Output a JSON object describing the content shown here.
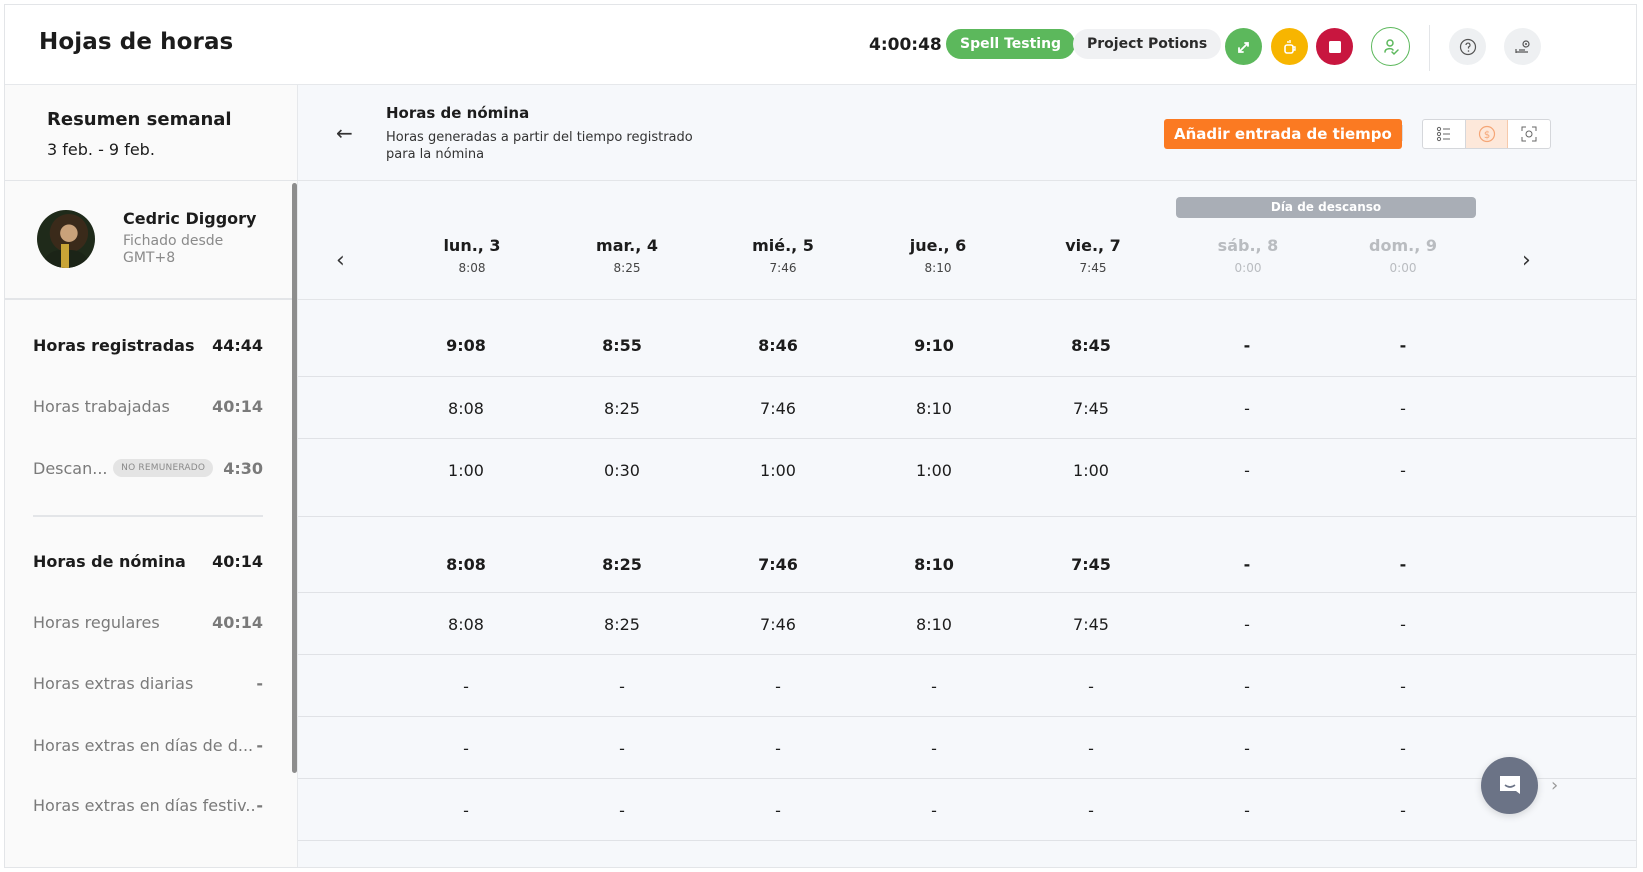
{
  "header": {
    "title": "Hojas de horas",
    "timer": "4:00:48",
    "active_activity": "Spell Testing",
    "active_project": "Project Potions",
    "colors": {
      "activity_green": "#5cb85c",
      "break_yellow": "#f7b500",
      "stop_red": "#c8163f",
      "accent_orange": "#fb7a22"
    },
    "icons": [
      "switch-activity-icon",
      "break-coffee-icon",
      "stop-icon",
      "user-check-icon",
      "help-icon",
      "settings-icon"
    ]
  },
  "summary": {
    "title": "Resumen semanal",
    "range": "3 feb. - 9 feb.",
    "user": {
      "name": "Cedric Diggory",
      "subtitle": "Fichado desde GMT+8"
    },
    "rows": [
      {
        "label": "Horas registradas",
        "value": "44:44"
      },
      {
        "label": "Horas trabajadas",
        "value": "40:14"
      },
      {
        "label": "Descan...",
        "badge": "NO REMUNERADO",
        "value": "4:30"
      },
      {
        "label": "Horas de nómina",
        "value": "40:14"
      },
      {
        "label": "Horas regulares",
        "value": "40:14"
      },
      {
        "label": "Horas extras diarias",
        "value": "-"
      },
      {
        "label": "Horas extras en días de d...",
        "value": "-"
      },
      {
        "label": "Horas extras en días festiv...",
        "value": "-"
      }
    ]
  },
  "main": {
    "title": "Horas de nómina",
    "subtitle": "Horas generadas a partir del tiempo registrado para la nómina",
    "add_button": "Añadir entrada de tiempo",
    "view_toggle": [
      "list-view",
      "payroll-view",
      "focus-view"
    ],
    "active_view": "payroll-view",
    "rest_day_label": "Día de descanso",
    "days": [
      {
        "name": "lun., 3",
        "hours": "8:08",
        "off": false
      },
      {
        "name": "mar., 4",
        "hours": "8:25",
        "off": false
      },
      {
        "name": "mié., 5",
        "hours": "7:46",
        "off": false
      },
      {
        "name": "jue., 6",
        "hours": "8:10",
        "off": false
      },
      {
        "name": "vie., 7",
        "hours": "7:45",
        "off": false
      },
      {
        "name": "sáb., 8",
        "hours": "0:00",
        "off": true
      },
      {
        "name": "dom., 9",
        "hours": "0:00",
        "off": true
      }
    ],
    "grid": [
      [
        "9:08",
        "8:55",
        "8:46",
        "9:10",
        "8:45",
        "-",
        "-"
      ],
      [
        "8:08",
        "8:25",
        "7:46",
        "8:10",
        "7:45",
        "-",
        "-"
      ],
      [
        "1:00",
        "0:30",
        "1:00",
        "1:00",
        "1:00",
        "-",
        "-"
      ],
      [
        "8:08",
        "8:25",
        "7:46",
        "8:10",
        "7:45",
        "-",
        "-"
      ],
      [
        "8:08",
        "8:25",
        "7:46",
        "8:10",
        "7:45",
        "-",
        "-"
      ],
      [
        "-",
        "-",
        "-",
        "-",
        "-",
        "-",
        "-"
      ],
      [
        "-",
        "-",
        "-",
        "-",
        "-",
        "-",
        "-"
      ],
      [
        "-",
        "-",
        "-",
        "-",
        "-",
        "-",
        "-"
      ]
    ]
  }
}
